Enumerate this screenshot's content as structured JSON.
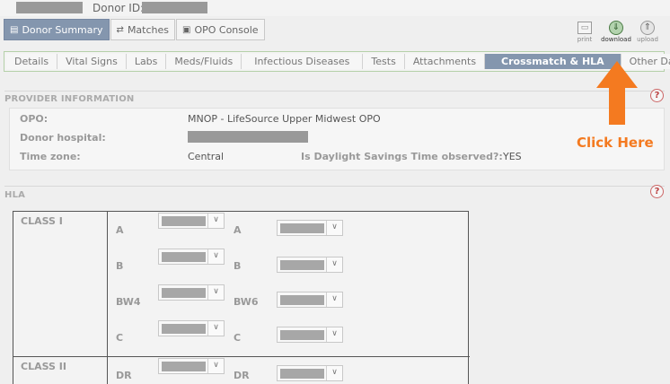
{
  "topbar": {
    "donor_id_label": "Donor ID:"
  },
  "mainnav": [
    {
      "label": "Donor Summary",
      "icon": "document-icon"
    },
    {
      "label": "Matches",
      "icon": "swap-arrows-icon"
    },
    {
      "label": "OPO Console",
      "icon": "console-icon"
    }
  ],
  "tools": {
    "print": "print",
    "download": "download",
    "upload": "upload"
  },
  "subtabs": [
    "Details",
    "Vital Signs",
    "Labs",
    "Meds/Fluids",
    "Infectious Diseases",
    "Tests",
    "Attachments",
    "Crossmatch & HLA",
    "Other Data"
  ],
  "provider": {
    "title": "PROVIDER INFORMATION",
    "opo_label": "OPO:",
    "opo_value": "MNOP - LifeSource Upper Midwest OPO",
    "hospital_label": "Donor hospital:",
    "timezone_label": "Time zone:",
    "timezone_value": "Central",
    "dst_label": "Is Daylight Savings Time observed?:",
    "dst_value": "YES"
  },
  "hla": {
    "title": "HLA",
    "class1": "CLASS I",
    "class2": "CLASS II",
    "class1_rows": [
      {
        "left": "A",
        "right": "A"
      },
      {
        "left": "B",
        "right": "B"
      },
      {
        "left": "BW4",
        "right": "BW6"
      },
      {
        "left": "C",
        "right": "C"
      }
    ],
    "class2_rows": [
      {
        "left": "DR",
        "right": "DR"
      }
    ]
  },
  "annotation": {
    "text": "Click Here",
    "color": "#f47a20"
  },
  "colors": {
    "active_tab": "#8496ae",
    "tab_border": "#b5d0a9"
  }
}
